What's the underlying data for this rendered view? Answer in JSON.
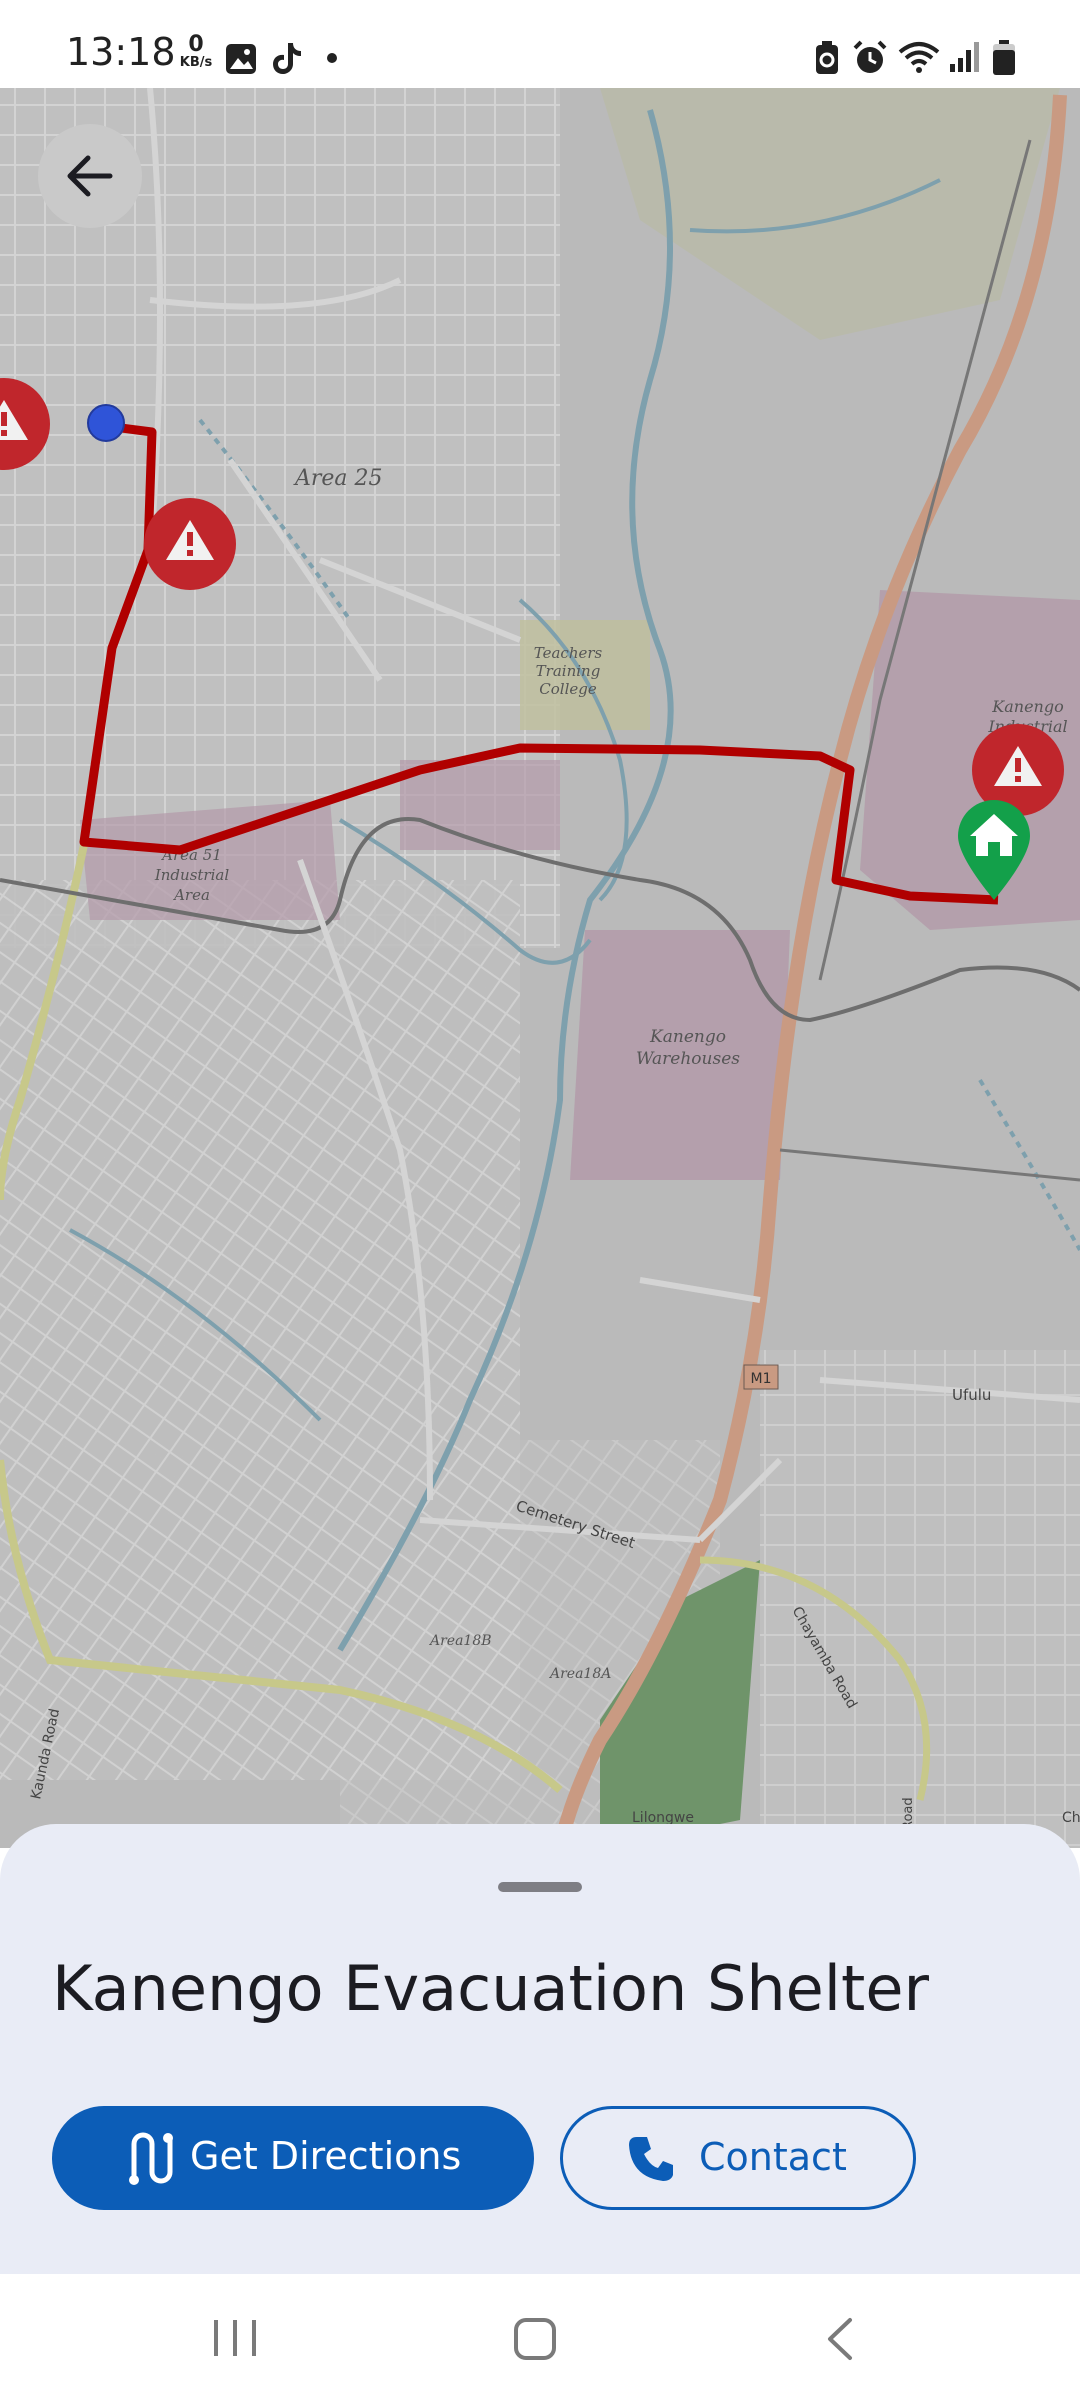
{
  "status_bar": {
    "time": "13:18",
    "net_speed_value": "0",
    "net_speed_unit": "KB/s",
    "left_icons": [
      "gallery-icon",
      "tiktok-icon",
      "dot-icon"
    ],
    "right_icons": [
      "battery-saver-icon",
      "alarm-icon",
      "wifi-icon",
      "signal-icon",
      "battery-icon"
    ]
  },
  "map": {
    "labels": {
      "area25": "Area 25",
      "teachers": [
        "Teachers",
        "Training",
        "College"
      ],
      "kanengo_industrial": [
        "Kanengo",
        "Industrial"
      ],
      "area51": [
        "Area 51",
        "Industrial",
        "Area"
      ],
      "warehouses": [
        "Kanengo",
        "Warehouses"
      ],
      "m1": "M1",
      "ufulu": "Ufulu",
      "cemetery": "Cemetery Street",
      "chayamba": "Chayamba Road",
      "area18b": "Area18B",
      "area18a": "Area18A",
      "kaunda": "Kaunda Road",
      "lilongwe": "Lilongwe",
      "ch": "Ch",
      "road_right": "Road"
    },
    "route_color": "#b00000",
    "hazard_color": "#c0262c",
    "shelter_color": "#13a04a",
    "origin_color": "#2f54d8"
  },
  "sheet": {
    "title": "Kanengo Evacuation Shelter",
    "directions_label": "Get Directions",
    "contact_label": "Contact",
    "accent": "#0c5db7"
  },
  "nav_bar": {
    "icons": [
      "recents-icon",
      "home-icon",
      "back-nav-icon"
    ]
  }
}
